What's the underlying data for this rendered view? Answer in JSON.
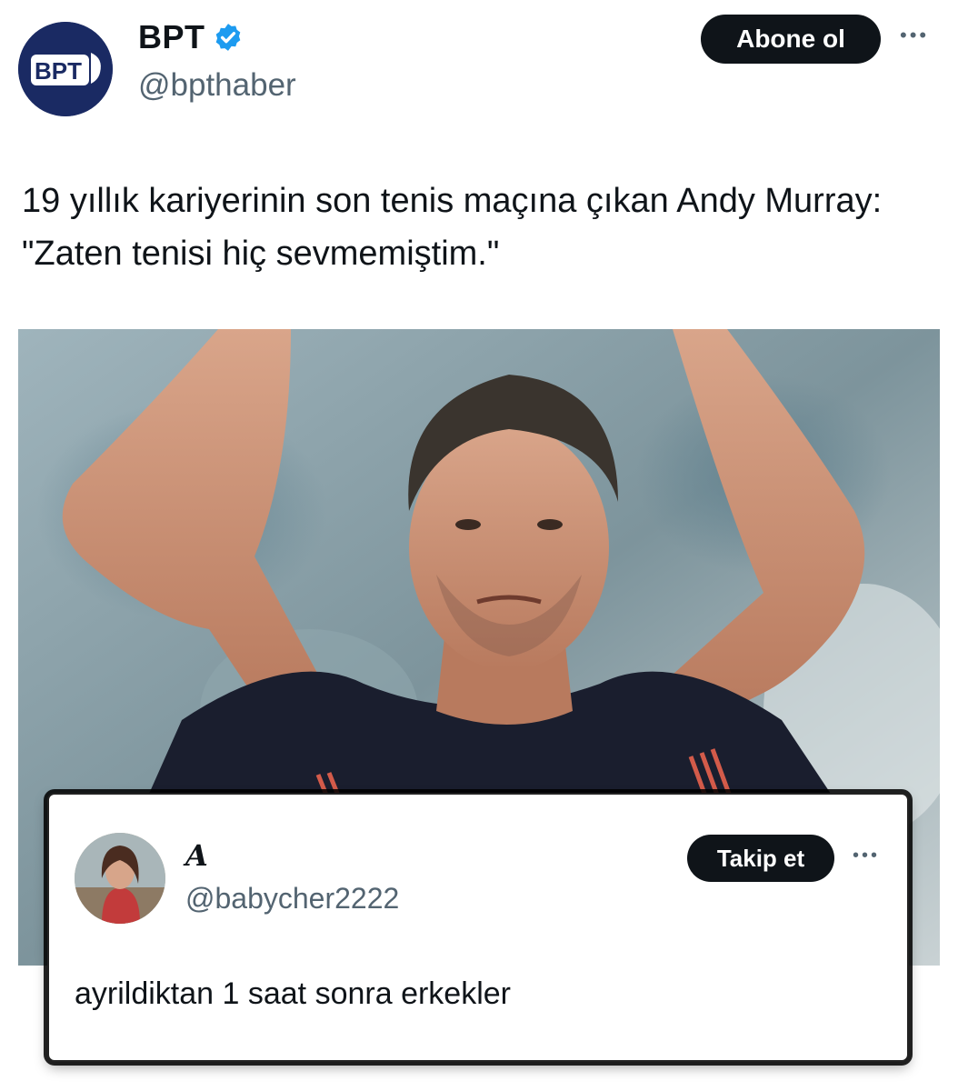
{
  "author": {
    "name": "BPT",
    "handle": "@bpthaber",
    "verified": true,
    "avatar_text": "BPT",
    "follow_label": "Abone ol",
    "more_label": "•••"
  },
  "tweet": {
    "text": "19 yıllık kariyerinin son tenis maçına çıkan Andy Murray: \"Zaten tenisi hiç sevmemiştim.\""
  },
  "media": {
    "icon": "photo-of-tennis-player-applauding"
  },
  "quoted_reply": {
    "name": "A",
    "handle": "@babycher2222",
    "follow_label": "Takip et",
    "more_label": "•••",
    "text": "ayrildiktan 1 saat sonra erkekler"
  },
  "colors": {
    "button_bg": "#0f1419",
    "secondary_text": "#536471",
    "verified_blue": "#1d9bf0",
    "logo_bg": "#1a2a63"
  }
}
